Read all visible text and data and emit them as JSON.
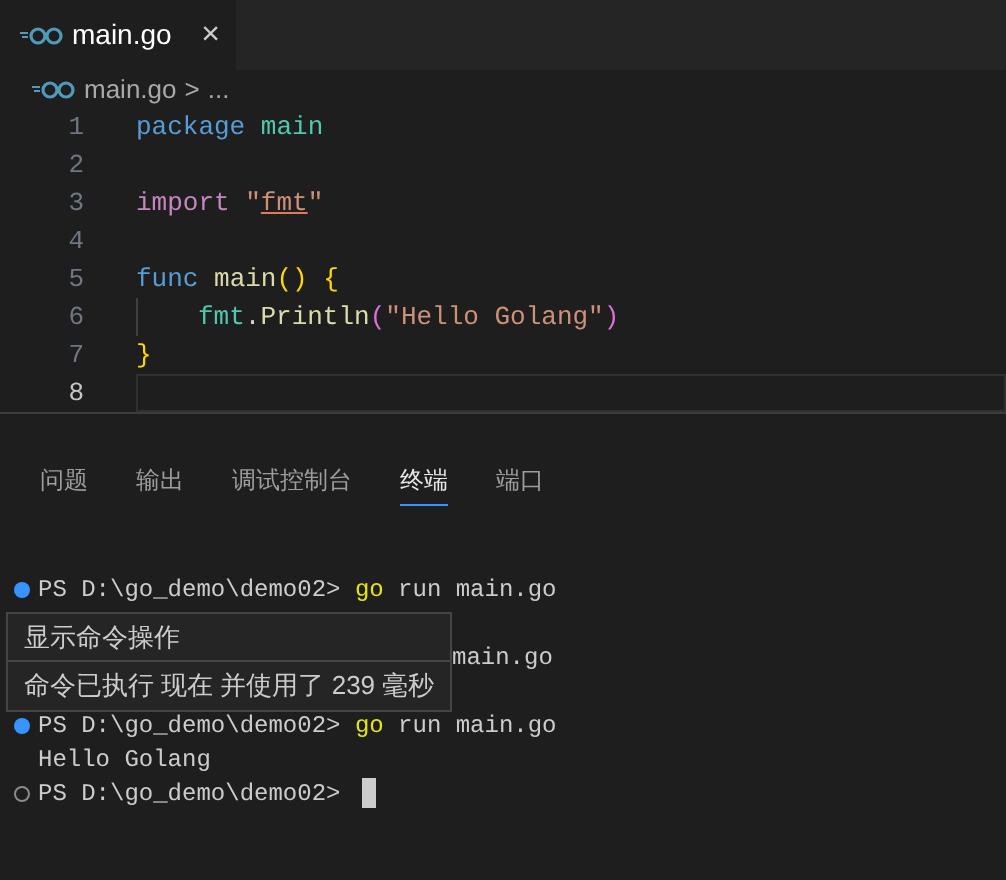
{
  "editor_tabs": [
    {
      "label": "main.go",
      "selected": true,
      "close": "×"
    }
  ],
  "breadcrumb": {
    "file": "main.go",
    "separator": ">",
    "rest": "..."
  },
  "code_lines": [
    {
      "number": "1",
      "active": false,
      "tokens": [
        {
          "text": "package ",
          "color": "#569cd6"
        },
        {
          "text": "main",
          "color": "#4ec9b0"
        }
      ]
    },
    {
      "number": "2",
      "active": false
    },
    {
      "number": "3",
      "active": false,
      "tokens": [
        {
          "text": "import ",
          "color": "#c586c0"
        },
        {
          "text": "\"",
          "color": "#ce9178"
        },
        {
          "text": "fmt",
          "color": "#ce9178",
          "underlined": true
        },
        {
          "text": "\"",
          "color": "#ce9178"
        }
      ]
    },
    {
      "number": "4",
      "active": false
    },
    {
      "number": "5",
      "active": false,
      "tokens": [
        {
          "text": "func ",
          "color": "#569cd6"
        },
        {
          "text": "main",
          "color": "#dcdcaa"
        },
        {
          "text": "() {",
          "color": "#ffd700"
        }
      ]
    },
    {
      "number": "6",
      "active": false,
      "indent": true,
      "tokens": [
        {
          "text": "fmt",
          "color": "#4ec9b0"
        },
        {
          "text": ".",
          "color": "#d4d4d4"
        },
        {
          "text": "Println",
          "color": "#dcdcaa"
        },
        {
          "text": "(",
          "color": "#da70d6"
        },
        {
          "text": "\"Hello Golang\"",
          "color": "#ce9178"
        },
        {
          "text": ")",
          "color": "#da70d6"
        }
      ]
    },
    {
      "number": "7",
      "active": false,
      "tokens": [
        {
          "text": "}",
          "color": "#ffd700"
        }
      ]
    },
    {
      "number": "8",
      "active": true
    }
  ],
  "panel_tabs": [
    {
      "label": "问题",
      "selected": false
    },
    {
      "label": "输出",
      "selected": false
    },
    {
      "label": "调试控制台",
      "selected": false
    },
    {
      "label": "终端",
      "selected": true
    },
    {
      "label": "端口",
      "selected": false
    }
  ],
  "terminal_lines": [
    {
      "dot_filled": true,
      "segments": [
        {
          "text": "PS D:\\go_demo\\demo02> "
        },
        {
          "text": "go",
          "kind": "command"
        },
        {
          "text": " run main.go"
        }
      ]
    },
    {
      "space_before": true,
      "segments": [
        {
          "text": "main.go",
          "kind": "partial"
        }
      ]
    },
    {
      "space_before": true,
      "dot_filled": true,
      "segments": [
        {
          "text": "PS D:\\go_demo\\demo02> "
        },
        {
          "text": "go",
          "kind": "command"
        },
        {
          "text": " run main.go"
        }
      ]
    },
    {
      "segments": [
        {
          "text": "Hello Golang"
        }
      ]
    },
    {
      "dot_filled": false,
      "cursor": true,
      "segments": [
        {
          "text": "PS D:\\go_demo\\demo02> "
        }
      ]
    }
  ],
  "hover_popup": {
    "title": "显示命令操作",
    "detail": "命令已执行 现在 并使用了 239 毫秒"
  }
}
